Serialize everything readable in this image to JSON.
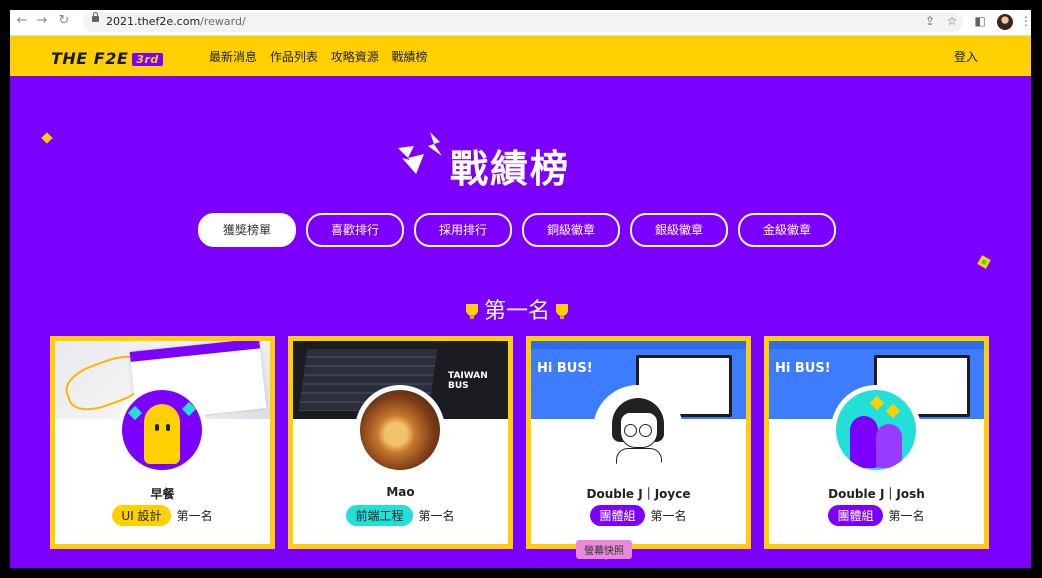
{
  "browser": {
    "url_host": "2021.thef2e.com",
    "url_path": "/reward/"
  },
  "header": {
    "logo_text": "THE F2E",
    "logo_badge": "3rd",
    "menu": [
      "最新消息",
      "作品列表",
      "攻略資源",
      "戰績榜"
    ],
    "login": "登入"
  },
  "hero": {
    "title": "戰績榜"
  },
  "tabs": [
    "獲獎榜單",
    "喜歡排行",
    "採用排行",
    "銅級徽章",
    "銀級徽章",
    "金級徽章"
  ],
  "active_tab": "獲獎榜單",
  "ranking": {
    "heading": "第一名"
  },
  "cards": [
    {
      "name": "早餐",
      "role": "UI 設計",
      "rank": "第一名",
      "role_color": "#ffd000"
    },
    {
      "name": "Mao",
      "role": "前端工程",
      "rank": "第一名",
      "role_color": "#22e0d8"
    },
    {
      "name": "Double J｜Joyce",
      "role": "團體組",
      "rank": "第一名",
      "role_color": "#7b00ff"
    },
    {
      "name": "Double J｜Josh",
      "role": "團體組",
      "rank": "第一名",
      "role_color": "#7b00ff"
    }
  ],
  "cover_texts": {
    "taiwan_bus": "TAIWAN BUS",
    "hi_bus": "Hi BUS!"
  },
  "tooltip": "螢幕快照",
  "colors": {
    "brand_purple": "#7b00ff",
    "brand_yellow": "#ffd000",
    "accent_cyan": "#22e0d8"
  }
}
